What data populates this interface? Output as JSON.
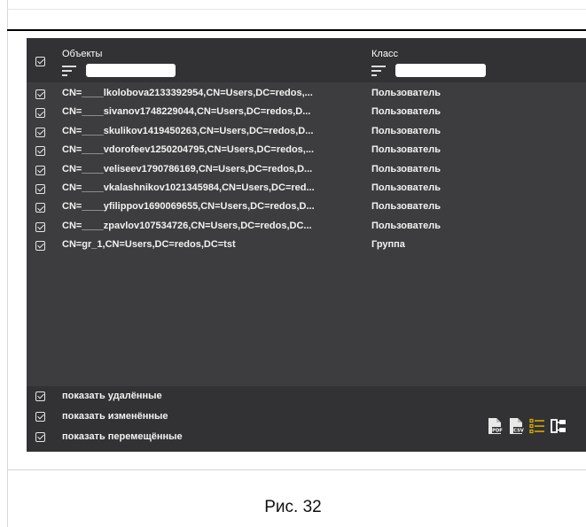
{
  "header": {
    "objects_label": "Объекты",
    "class_label": "Класс"
  },
  "rows": [
    {
      "object": "CN=____lkolobova2133392954,CN=Users,DC=redos,...",
      "class": "Пользователь"
    },
    {
      "object": "CN=____sivanov1748229044,CN=Users,DC=redos,D...",
      "class": "Пользователь"
    },
    {
      "object": "CN=____skulikov1419450263,CN=Users,DC=redos,D...",
      "class": "Пользователь"
    },
    {
      "object": "CN=____vdorofeev1250204795,CN=Users,DC=redos,...",
      "class": "Пользователь"
    },
    {
      "object": "CN=____veliseev1790786169,CN=Users,DC=redos,D...",
      "class": "Пользователь"
    },
    {
      "object": "CN=____vkalashnikov1021345984,CN=Users,DC=red...",
      "class": "Пользователь"
    },
    {
      "object": "CN=____yfilippov1690069655,CN=Users,DC=redos,D...",
      "class": "Пользователь"
    },
    {
      "object": "CN=____zpavlov107534726,CN=Users,DC=redos,DC...",
      "class": "Пользователь"
    },
    {
      "object": "CN=gr_1,CN=Users,DC=redos,DC=tst",
      "class": "Группа"
    }
  ],
  "footer": {
    "show_deleted": "показать удалённые",
    "show_changed": "показать изменённые",
    "show_moved": "показать перемещённые",
    "pdf_icon_text": "PDF",
    "csv_icon_text": "CSV"
  },
  "icons": {
    "export_pdf": "file-pdf-icon",
    "export_csv": "file-csv-icon",
    "list_view": "list-view-icon",
    "tree_view": "tree-view-icon"
  },
  "colors": {
    "panel_bg": "#3d3d3f",
    "list_icon": "#e0b000"
  },
  "caption": "Рис. 32"
}
